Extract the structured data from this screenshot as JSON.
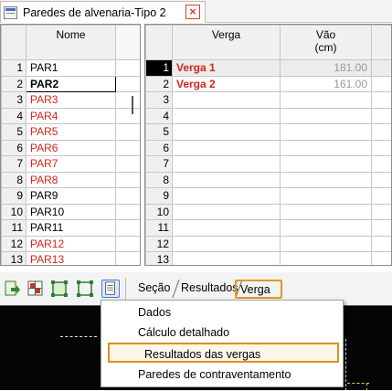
{
  "window_tab": {
    "title": "Paredes de alvenaria-Tipo 2",
    "close_glyph": "×",
    "icon": "app-icon"
  },
  "left_grid": {
    "header": "Nome",
    "rows": [
      {
        "index": "1",
        "name": "PAR1",
        "style": "normal"
      },
      {
        "index": "2",
        "name": "PAR2",
        "style": "bold-current"
      },
      {
        "index": "3",
        "name": "PAR3",
        "style": "red"
      },
      {
        "index": "4",
        "name": "PAR4",
        "style": "red"
      },
      {
        "index": "5",
        "name": "PAR5",
        "style": "red"
      },
      {
        "index": "6",
        "name": "PAR6",
        "style": "red"
      },
      {
        "index": "7",
        "name": "PAR7",
        "style": "red"
      },
      {
        "index": "8",
        "name": "PAR8",
        "style": "red"
      },
      {
        "index": "9",
        "name": "PAR9",
        "style": "normal"
      },
      {
        "index": "10",
        "name": "PAR10",
        "style": "normal"
      },
      {
        "index": "11",
        "name": "PAR11",
        "style": "normal"
      },
      {
        "index": "12",
        "name": "PAR12",
        "style": "red"
      },
      {
        "index": "13",
        "name": "PAR13",
        "style": "red"
      }
    ]
  },
  "right_grid": {
    "header_verga": "Verga",
    "header_vao": "Vão",
    "header_vao_unit": "(cm)",
    "rows": [
      {
        "index": "1",
        "verga": "Verga 1",
        "vao": "181.00",
        "selected": true
      },
      {
        "index": "2",
        "verga": "Verga 2",
        "vao": "161.00",
        "selected": false
      },
      {
        "index": "3",
        "verga": "",
        "vao": ""
      },
      {
        "index": "4",
        "verga": "",
        "vao": ""
      },
      {
        "index": "5",
        "verga": "",
        "vao": ""
      },
      {
        "index": "6",
        "verga": "",
        "vao": ""
      },
      {
        "index": "7",
        "verga": "",
        "vao": ""
      },
      {
        "index": "8",
        "verga": "",
        "vao": ""
      },
      {
        "index": "9",
        "verga": "",
        "vao": ""
      },
      {
        "index": "10",
        "verga": "",
        "vao": ""
      },
      {
        "index": "11",
        "verga": "",
        "vao": ""
      },
      {
        "index": "12",
        "verga": "",
        "vao": ""
      },
      {
        "index": "13",
        "verga": "",
        "vao": ""
      }
    ]
  },
  "toolbar": {
    "buttons": [
      "export-icon",
      "table-icon",
      "select-icon",
      "frame-icon",
      "document-icon"
    ],
    "sheet_tabs": [
      "Seção",
      "Resultados",
      "Verga"
    ],
    "active_tab": "Verga"
  },
  "context_menu": {
    "items": [
      "Dados",
      "Cálculo detalhado",
      "Resultados das vergas",
      "Paredes de contraventamento"
    ],
    "highlighted": "Resultados das vergas"
  },
  "colors": {
    "highlight_border": "#e09a1c",
    "red_text": "#d3241c",
    "canvas_bg": "#050505"
  }
}
